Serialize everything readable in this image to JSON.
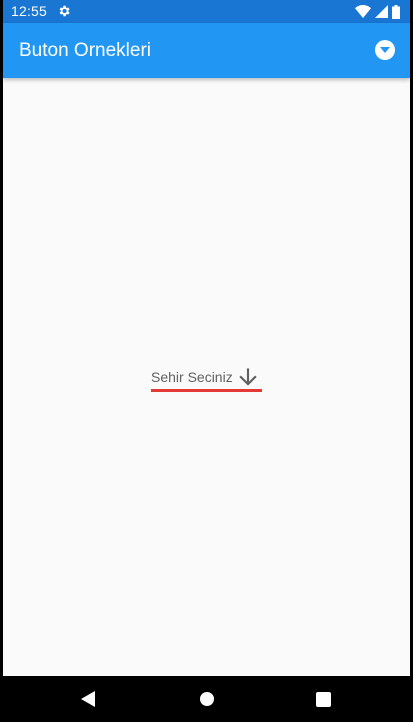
{
  "status_bar": {
    "time": "12:55",
    "settings_icon": "gear-icon",
    "wifi_icon": "wifi-icon",
    "signal_icon": "signal-icon",
    "battery_icon": "battery-icon",
    "background_color": "#1976D2"
  },
  "app_bar": {
    "title": "Buton Ornekleri",
    "action_icon": "dropdown-circle-icon",
    "background_color": "#2196F3"
  },
  "content": {
    "dropdown": {
      "hint": "Sehir Seciniz",
      "icon": "arrow-down-icon",
      "underline_color": "#E53935"
    }
  },
  "nav_bar": {
    "back_icon": "back-triangle-icon",
    "home_icon": "home-circle-icon",
    "recents_icon": "recents-square-icon"
  }
}
